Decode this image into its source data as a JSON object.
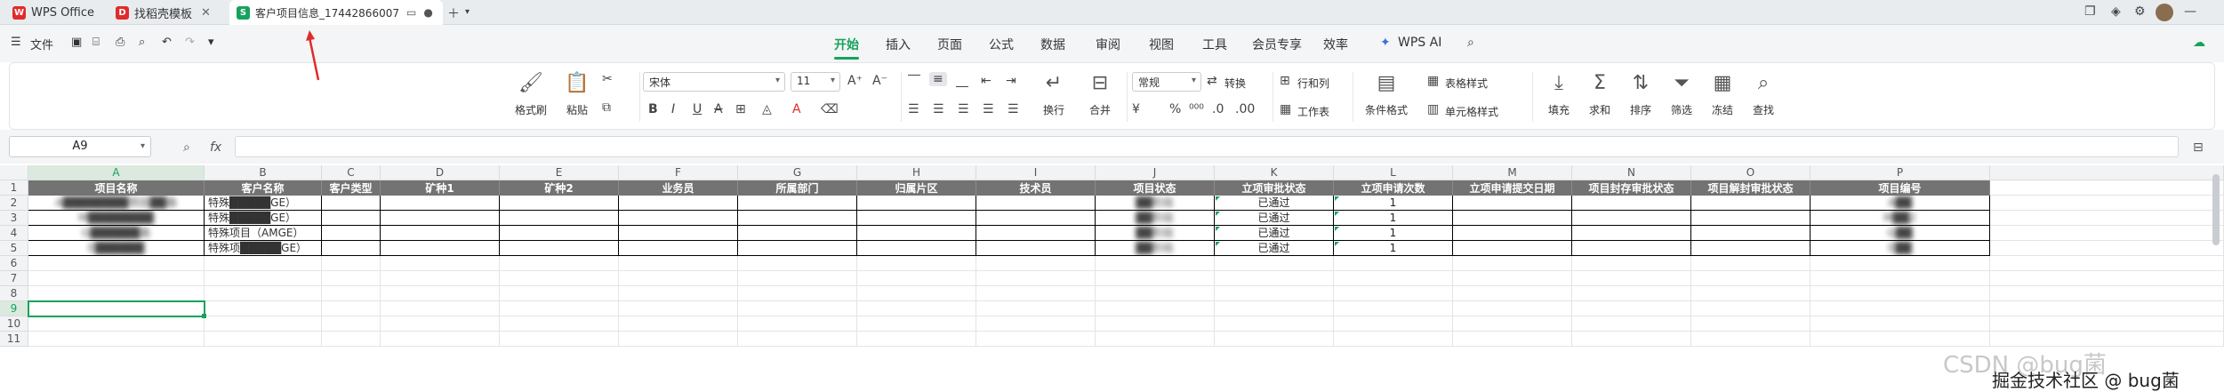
{
  "tabs": [
    {
      "label": "WPS Office",
      "icon": "wps-logo-icon",
      "color": "#e02b2b",
      "active": false
    },
    {
      "label": "找稻壳模板",
      "icon": "docer-icon",
      "color": "#e02b2b",
      "active": false
    },
    {
      "label": "客户项目信息_17442866007",
      "icon": "spreadsheet-icon",
      "color": "#15a35c",
      "active": true
    }
  ],
  "tab_icon_letters": {
    "wps": "W",
    "docer": "D",
    "sheet": "S"
  },
  "menu": {
    "file_label": "文件",
    "tabs": [
      "开始",
      "插入",
      "页面",
      "公式",
      "数据",
      "审阅",
      "视图",
      "工具",
      "会员专享",
      "效率",
      "WPS AI"
    ],
    "active_tab": "开始"
  },
  "ribbon": {
    "format_painter": "格式刷",
    "paste": "粘贴",
    "font_name": "宋体",
    "font_size": "11",
    "wrap": "换行",
    "merge": "合并",
    "number_format": "常规",
    "convert": "转换",
    "row_col": "行和列",
    "worksheet": "工作表",
    "cond_format": "条件格式",
    "table_style": "表格样式",
    "cell_style": "单元格样式",
    "fill": "填充",
    "sum": "求和",
    "sort": "排序",
    "filter": "筛选",
    "freeze": "冻结",
    "find": "查找"
  },
  "formula_bar": {
    "name_box": "A9",
    "fx": "fx",
    "value": ""
  },
  "columns": [
    "A",
    "B",
    "C",
    "D",
    "E",
    "F",
    "G",
    "H",
    "I",
    "J",
    "K",
    "L",
    "M",
    "N",
    "O",
    "P"
  ],
  "rows": [
    "1",
    "2",
    "3",
    "4",
    "5",
    "6",
    "7",
    "8",
    "9",
    "10",
    "11"
  ],
  "selected_cell": "A9",
  "headers": [
    "项目名称",
    "客户名称",
    "客户类型",
    "矿种1",
    "矿种2",
    "业务员",
    "所属部门",
    "归属片区",
    "技术员",
    "项目状态",
    "立项审批状态",
    "立项申请次数",
    "立项申请提交日期",
    "项目封存审批状态",
    "项目解封审批状态",
    "项目编号"
  ],
  "data_rows": [
    {
      "A": "A████████项目██路",
      "B": "特殊█████GE）",
      "J": "██阶段",
      "K": "已通过",
      "L": "1",
      "P": "A██"
    },
    {
      "A": "M████████",
      "B": "特殊█████GE）",
      "J": "██阶段",
      "K": "已通过",
      "L": "1",
      "P": "M██2"
    },
    {
      "A": "G██████路",
      "B": "特殊项目（AMGE）",
      "J": "██阶段",
      "K": "已通过",
      "L": "1",
      "P": "G██"
    },
    {
      "A": "E██████",
      "B": "特殊项█████GE）",
      "J": "██阶段",
      "K": "已通过",
      "L": "1",
      "P": "E██"
    }
  ],
  "watermark": "CSDN @bug菌",
  "credit": "掘金技术社区 @ bug菌"
}
